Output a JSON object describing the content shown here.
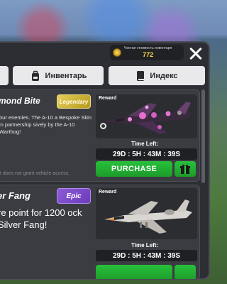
{
  "header": {
    "inventory_value_label": "Чистая стоимость инвентаря",
    "inventory_value": "772"
  },
  "tabs": [
    {
      "label": "Инвентарь",
      "icon": "backpack-icon"
    },
    {
      "label": "Индекс",
      "icon": "book-icon"
    }
  ],
  "offers": [
    {
      "title": "mond Bite",
      "rarity": "Legendary",
      "description": "our enemies. The A-10 a Bespoke Skin in partnership sively by the A-10 Warthog!",
      "note": "t does not grant vehicle access.",
      "reward_label": "Reward",
      "time_left_label": "Time Left:",
      "timer": "29D : 5H : 43M : 39S",
      "purchase_label": "PURCHASE",
      "colors": {
        "rarity": "#d6bd3a",
        "button": "#22b033"
      }
    },
    {
      "title": "er Fang",
      "rarity": "Epic",
      "description": "re point for 1200 ock Silver Fang!",
      "reward_label": "Reward",
      "time_left_label": "Time Left:",
      "timer": "29D : 5H : 43M : 39S",
      "colors": {
        "rarity": "#7d4bcc",
        "button": "#22b033"
      }
    }
  ],
  "colors": {
    "panel": "#2c2e33",
    "accent_gold": "#ffd84a"
  }
}
